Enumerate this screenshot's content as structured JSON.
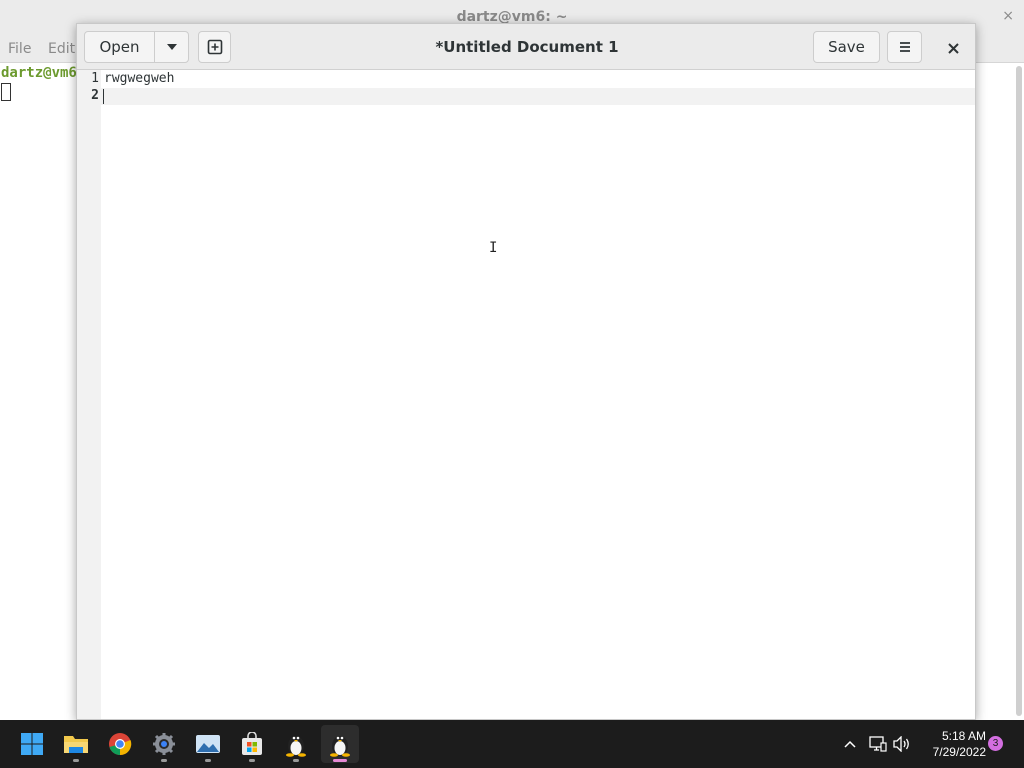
{
  "terminal": {
    "title": "dartz@vm6: ~",
    "close_glyph": "×",
    "menu": [
      "File",
      "Edit"
    ],
    "prompt": "dartz@vm6"
  },
  "gedit": {
    "title": "*Untitled Document 1",
    "open_label": "Open",
    "save_label": "Save",
    "lines": [
      {
        "number": "1",
        "text": "rwgwegweh"
      },
      {
        "number": "2",
        "text": ""
      }
    ]
  },
  "taskbar": {
    "apps": [
      "windows-start-icon",
      "file-explorer-icon",
      "chrome-icon",
      "settings-icon",
      "photos-icon",
      "microsoft-store-icon",
      "linux-penguin-icon",
      "linux-penguin-icon"
    ],
    "time": "5:18 AM",
    "date": "7/29/2022",
    "notification_count": "3"
  },
  "colors": {
    "prompt_green": "#6c9a2e",
    "taskbar_bg": "#1c1c1c",
    "active_indicator": "#e88ad6",
    "notification_badge": "#d36ee0"
  }
}
